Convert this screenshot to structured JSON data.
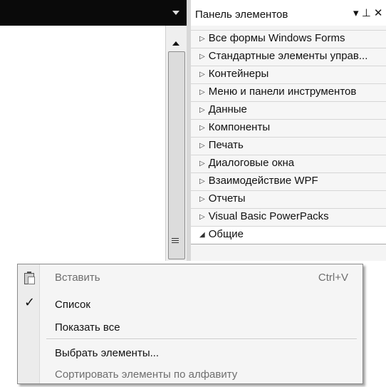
{
  "toolbox": {
    "title": "Панель элементов",
    "controls": "▾ ⊥ ✕",
    "tabs": [
      {
        "label": "Все формы Windows Forms",
        "expanded": false
      },
      {
        "label": "Стандартные элементы управ...",
        "expanded": false
      },
      {
        "label": "Контейнеры",
        "expanded": false
      },
      {
        "label": "Меню и панели инструментов",
        "expanded": false
      },
      {
        "label": "Данные",
        "expanded": false
      },
      {
        "label": "Компоненты",
        "expanded": false
      },
      {
        "label": "Печать",
        "expanded": false
      },
      {
        "label": "Диалоговые окна",
        "expanded": false
      },
      {
        "label": "Взаимодействие WPF",
        "expanded": false
      },
      {
        "label": "Отчеты",
        "expanded": false
      },
      {
        "label": "Visual Basic PowerPacks",
        "expanded": false
      },
      {
        "label": "Общие",
        "expanded": true
      }
    ],
    "collapsed_arrow": "▷",
    "expanded_arrow": "◢"
  },
  "context_menu": {
    "items": [
      {
        "label": "Вставить",
        "shortcut": "Ctrl+V",
        "enabled": false,
        "icon": "paste-icon"
      },
      {
        "label": "Список",
        "checked": true,
        "enabled": true
      },
      {
        "label": "Показать все",
        "enabled": true
      },
      {
        "label": "Выбрать элементы...",
        "enabled": true
      },
      {
        "label": "Сортировать элементы по алфавиту",
        "enabled": false
      }
    ],
    "check_glyph": "✓"
  }
}
